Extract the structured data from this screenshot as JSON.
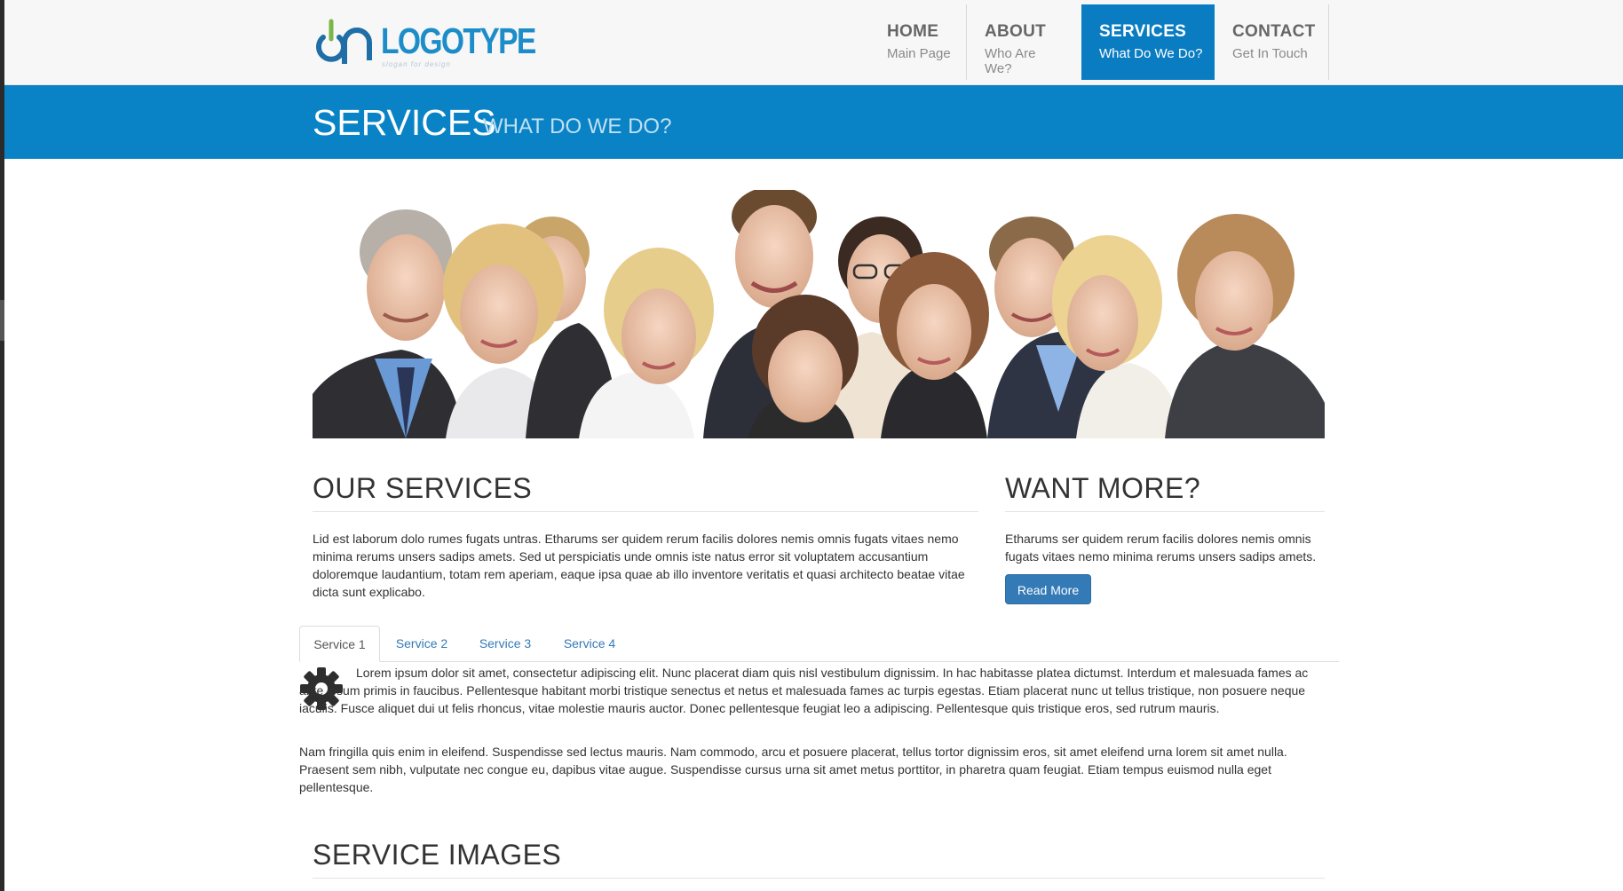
{
  "header": {
    "logo_text": "LOGOTYPE",
    "logo_tagline": "slogan for design",
    "nav": [
      {
        "title": "HOME",
        "sub": "Main Page",
        "active": false
      },
      {
        "title": "ABOUT",
        "sub": "Who Are We?",
        "active": false
      },
      {
        "title": "SERVICES",
        "sub": "What Do We Do?",
        "active": true
      },
      {
        "title": "CONTACT",
        "sub": "Get In Touch",
        "active": false
      }
    ]
  },
  "title_bar": {
    "title": "SERVICES",
    "subtitle": "WHAT DO WE DO?"
  },
  "our_services": {
    "heading": "OUR SERVICES",
    "text": "Lid est laborum dolo rumes fugats untras. Etharums ser quidem rerum facilis dolores nemis omnis fugats vitaes nemo minima rerums unsers sadips amets. Sed ut perspiciatis unde omnis iste natus error sit voluptatem accusantium doloremque laudantium, totam rem aperiam, eaque ipsa quae ab illo inventore veritatis et quasi architecto beatae vitae dicta sunt explicabo."
  },
  "want_more": {
    "heading": "WANT MORE?",
    "text": "Etharums ser quidem rerum facilis dolores nemis omnis fugats vitaes nemo minima rerums unsers sadips amets.",
    "button_label": "Read More"
  },
  "tabs": {
    "items": [
      "Service 1",
      "Service 2",
      "Service 3",
      "Service 4"
    ],
    "active_index": 0,
    "para1": "Lorem ipsum dolor sit amet, consectetur adipiscing elit. Nunc placerat diam quis nisl vestibulum dignissim. In hac habitasse platea dictumst. Interdum et malesuada fames ac ante ipsum primis in faucibus. Pellentesque habitant morbi tristique senectus et netus et malesuada fames ac turpis egestas. Etiam placerat nunc ut tellus tristique, non posuere neque iaculis. Fusce aliquet dui ut felis rhoncus, vitae molestie mauris auctor. Donec pellentesque feugiat leo a adipiscing. Pellentesque quis tristique eros, sed rutrum mauris.",
    "para2": "Nam fringilla quis enim in eleifend. Suspendisse sed lectus mauris. Nam commodo, arcu et posuere placerat, tellus tortor dignissim eros, sit amet eleifend urna lorem sit amet nulla. Praesent sem nibh, vulputate nec congue eu, dapibus vitae augue. Suspendisse cursus urna sit amet metus porttitor, in pharetra quam feugiat. Etiam tempus euismod nulla eget pellentesque.",
    "icon": "gear-icon"
  },
  "service_images": {
    "heading": "SERVICE IMAGES"
  },
  "colors": {
    "brand_blue": "#0a83c6",
    "nav_active": "#0a7dc2",
    "button_blue": "#337ab7",
    "logo_green": "#6aa84f"
  }
}
